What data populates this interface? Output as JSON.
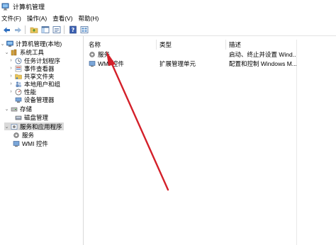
{
  "window": {
    "title": "计算机管理"
  },
  "menu": [
    "文件(F)",
    "操作(A)",
    "查看(V)",
    "帮助(H)"
  ],
  "toolbar": {
    "buttons": [
      "back-arrow-icon",
      "forward-arrow-icon",
      "folder-up-icon",
      "properties-icon",
      "show-hide-tree-icon",
      "help-icon",
      "view-icon"
    ]
  },
  "tree": {
    "root": "计算机管理(本地)",
    "system_tools": "系统工具",
    "task_scheduler": "任务计划程序",
    "event_viewer": "事件查看器",
    "shared_folders": "共享文件夹",
    "local_users": "本地用户和组",
    "performance": "性能",
    "device_manager": "设备管理器",
    "storage": "存储",
    "disk_management": "磁盘管理",
    "services_apps": "服务和应用程序",
    "services": "服务",
    "wmi": "WMI 控件"
  },
  "list": {
    "headers": {
      "name": "名称",
      "type": "类型",
      "desc": "描述"
    },
    "rows": [
      {
        "name": "服务",
        "type": "",
        "desc": "启动、终止并设置 Wind..."
      },
      {
        "name": "WMI 控件",
        "type": "扩展管理单元",
        "desc": "配置和控制 Windows M..."
      }
    ]
  },
  "colors": {
    "selection": "#d9d9d9",
    "arrow": "#d4202a"
  }
}
